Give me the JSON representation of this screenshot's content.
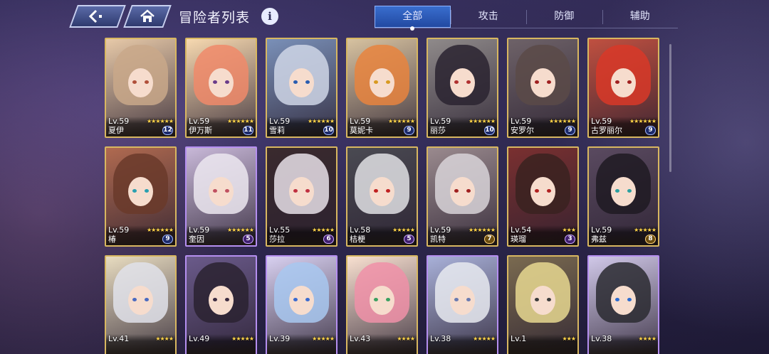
{
  "header": {
    "back_icon": "back-arrow-icon",
    "home_icon": "home-icon",
    "title": "冒险者列表",
    "info_label": "i"
  },
  "tabs": [
    {
      "label": "全部",
      "active": true
    },
    {
      "label": "攻击",
      "active": false
    },
    {
      "label": "防御",
      "active": false
    },
    {
      "label": "辅助",
      "active": false
    }
  ],
  "colors": {
    "frame_gold": "#d8b760",
    "frame_purple": "#b58ff0",
    "tab_active": "#2f5fc0"
  },
  "cards": [
    {
      "level": "Lv.59",
      "name": "夏伊",
      "stars": 6,
      "badge": "12",
      "frame": "gold",
      "badge_style": "blue",
      "hair": "#c9a88a",
      "eye": "#b0503a",
      "bg": "#e7c9a8"
    },
    {
      "level": "Lv.59",
      "name": "伊万斯",
      "stars": 6,
      "badge": "11",
      "frame": "gold",
      "badge_style": "blue",
      "hair": "#f08a6a",
      "eye": "#6a3b8a",
      "bg": "#f7d9b0"
    },
    {
      "level": "Lv.59",
      "name": "雪莉",
      "stars": 6,
      "badge": "10",
      "frame": "gold",
      "badge_style": "blue",
      "hair": "#cfd6e6",
      "eye": "#2a5db0",
      "bg": "#7a90b8"
    },
    {
      "level": "Lv.59",
      "name": "莫妮卡",
      "stars": 6,
      "badge": "9",
      "frame": "gold",
      "badge_style": "blue",
      "hair": "#e8843e",
      "eye": "#d89a20",
      "bg": "#d7c2a0"
    },
    {
      "level": "Lv.59",
      "name": "丽莎",
      "stars": 6,
      "badge": "10",
      "frame": "gold",
      "badge_style": "blue",
      "hair": "#2a2330",
      "eye": "#b03030",
      "bg": "#8f8a8a"
    },
    {
      "level": "Lv.59",
      "name": "安罗尔",
      "stars": 6,
      "badge": "9",
      "frame": "gold",
      "badge_style": "blue",
      "hair": "#5a4a48",
      "eye": "#a02020",
      "bg": "#6e6268"
    },
    {
      "level": "Lv.59",
      "name": "古罗丽尔",
      "stars": 6,
      "badge": "9",
      "frame": "gold",
      "badge_style": "blue",
      "hair": "#d83828",
      "eye": "#a02020",
      "bg": "#c05040"
    },
    {
      "level": "Lv.59",
      "name": "椿",
      "stars": 6,
      "badge": "9",
      "frame": "gold",
      "badge_style": "blue",
      "hair": "#6a3a2a",
      "eye": "#2aa0b0",
      "bg": "#b06a50"
    },
    {
      "level": "Lv.59",
      "name": "奎因",
      "stars": 6,
      "badge": "5",
      "frame": "purple",
      "badge_style": "purple",
      "hair": "#ece8f0",
      "eye": "#c05060",
      "bg": "#c8b8d8"
    },
    {
      "level": "Lv.55",
      "name": "莎拉",
      "stars": 5,
      "badge": "6",
      "frame": "gold",
      "badge_style": "purple",
      "hair": "#e8e0e8",
      "eye": "#c03040",
      "bg": "#3a2a2e"
    },
    {
      "level": "Lv.58",
      "name": "桔梗",
      "stars": 5,
      "badge": "5",
      "frame": "gold",
      "badge_style": "purple",
      "hair": "#e0e0e4",
      "eye": "#c02020",
      "bg": "#4a4a52"
    },
    {
      "level": "Lv.59",
      "name": "凯特",
      "stars": 6,
      "badge": "7",
      "frame": "gold",
      "badge_style": "gold",
      "hair": "#d8d4d8",
      "eye": "#a02020",
      "bg": "#9a8a8e"
    },
    {
      "level": "Lv.54",
      "name": "瑛瑠",
      "stars": 3,
      "badge": "3",
      "frame": "gold",
      "badge_style": "purple",
      "hair": "#3a2220",
      "eye": "#b02020",
      "bg": "#7a3030"
    },
    {
      "level": "Lv.59",
      "name": "弗兹",
      "stars": 5,
      "badge": "8",
      "frame": "gold",
      "badge_style": "gold",
      "hair": "#1e1a22",
      "eye": "#2aa0a0",
      "bg": "#5a4a60"
    },
    {
      "level": "Lv.41",
      "name": "",
      "stars": 4,
      "badge": "",
      "frame": "gold",
      "badge_style": "blue",
      "hair": "#e0e2ea",
      "eye": "#4a6ac0",
      "bg": "#e8dcc0"
    },
    {
      "level": "Lv.49",
      "name": "",
      "stars": 5,
      "badge": "",
      "frame": "purple",
      "badge_style": "blue",
      "hair": "#2a2230",
      "eye": "#3a2a40",
      "bg": "#6a5a8a"
    },
    {
      "level": "Lv.39",
      "name": "",
      "stars": 5,
      "badge": "",
      "frame": "purple",
      "badge_style": "blue",
      "hair": "#a8c8f0",
      "eye": "#3a6ad0",
      "bg": "#d8d0f0"
    },
    {
      "level": "Lv.43",
      "name": "",
      "stars": 4,
      "badge": "",
      "frame": "gold",
      "badge_style": "blue",
      "hair": "#f090a8",
      "eye": "#3aa060",
      "bg": "#f8e0d0"
    },
    {
      "level": "Lv.38",
      "name": "",
      "stars": 5,
      "badge": "",
      "frame": "purple",
      "badge_style": "blue",
      "hair": "#e8eaf0",
      "eye": "#6a7ab0",
      "bg": "#a8b0d8"
    },
    {
      "level": "Lv.1",
      "name": "",
      "stars": 3,
      "badge": "",
      "frame": "gold",
      "badge_style": "blue",
      "hair": "#e8d890",
      "eye": "#3a3a3a",
      "bg": "#7a6a50"
    },
    {
      "level": "Lv.38",
      "name": "",
      "stars": 4,
      "badge": "",
      "frame": "purple",
      "badge_style": "blue",
      "hair": "#2a2a30",
      "eye": "#2a6ad0",
      "bg": "#d0c8e8"
    }
  ]
}
